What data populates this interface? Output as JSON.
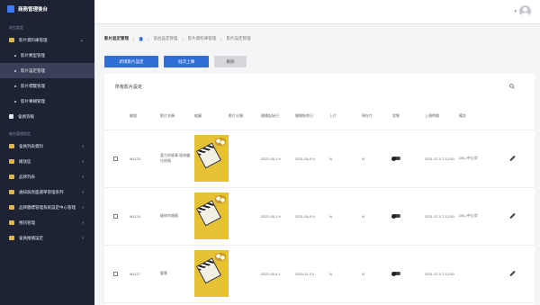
{
  "app": {
    "title": "商務管理後台"
  },
  "sidebar": {
    "section1": "前台設定",
    "items1": [
      {
        "label": "影片資料庫管理",
        "type": "folder",
        "chev": "⌄"
      },
      {
        "label": "影片類型管理",
        "type": "sub"
      },
      {
        "label": "影片設定管理",
        "type": "sub",
        "active": true
      },
      {
        "label": "影片標籤管理",
        "type": "sub"
      },
      {
        "label": "影片專輯管理",
        "type": "sub"
      },
      {
        "label": "會員等級",
        "type": "plain"
      }
    ],
    "section2": "後台管理設定",
    "items2": [
      {
        "label": "會員列表資料",
        "chev": "›"
      },
      {
        "label": "播放區",
        "chev": "›"
      },
      {
        "label": "品牌列表",
        "chev": "›"
      },
      {
        "label": "通知與頁面選單管理系列",
        "chev": "›"
      },
      {
        "label": "品牌圖標管理系統設定中心管理",
        "chev": "›"
      },
      {
        "label": "視訊管理",
        "chev": "›"
      },
      {
        "label": "會員推播設定",
        "chev": "›"
      }
    ]
  },
  "topbar": {
    "dropdown": "▾"
  },
  "breadcrumb": {
    "title": "影片設定管理",
    "crumbs": [
      "前台設定管理",
      "影片資料庫管理",
      "影片設定管理"
    ]
  },
  "actions": {
    "add": "新增影片設定",
    "batch": "批次上傳",
    "delete": "刪除"
  },
  "card": {
    "title": "所有影片設定"
  },
  "table": {
    "headers": [
      "編號",
      "影片名稱",
      "縮圖",
      "影片分類",
      "開播起始日",
      "開播結束日",
      "上片",
      "現在片",
      "狀態",
      "上傳時間",
      "備註"
    ],
    "rows": [
      {
        "id": "M1123",
        "name": "愛方的故事 經典繼位修復",
        "start": "2021-05-1 9",
        "end": "2021-06-0 9",
        "up": "N",
        "now": "N",
        "uploaded": "2021-07-0 2 12:00",
        "note": "DEL/中山廿"
      },
      {
        "id": "M1124",
        "name": "破碎的婚姻",
        "start": "2021-05-1 9",
        "end": "2021-06-0 9",
        "up": "N",
        "now": "N",
        "uploaded": "2021-07-0 2 12:00",
        "note": "DEL/中山廿"
      },
      {
        "id": "M1127",
        "name": "重景",
        "start": "2021-05-0 1",
        "end": "2023-11-3 0",
        "up": "N",
        "now": "N",
        "uploaded": "2021-07-0 2 12:00",
        "note": ""
      }
    ]
  },
  "icons": {
    "home": "home-icon",
    "search": "search-icon",
    "user": "user-avatar-icon",
    "edit": "pencil-icon",
    "toggle": "toggle-icon"
  },
  "colors": {
    "sidebar": "#1d2235",
    "primary": "#2f6ed6",
    "thumb": "#e7c135"
  }
}
